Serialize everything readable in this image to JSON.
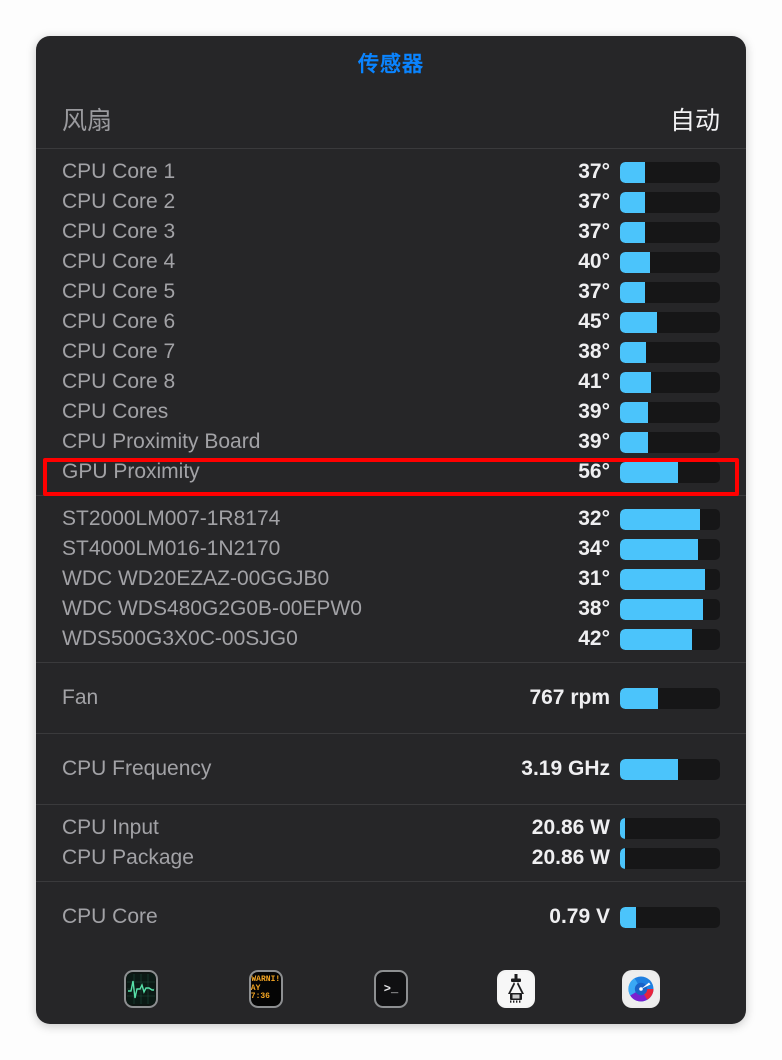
{
  "window": {
    "title": "传感器",
    "accent_color": "#0a84ff",
    "panel_color": "#262628",
    "bar_color": "#4bc4fb",
    "bar_track_color": "#161617",
    "highlight_color": "#ff0000"
  },
  "fan_header": {
    "label": "风扇",
    "value": "自动"
  },
  "sections": [
    {
      "name": "temperatures-cpu",
      "rows": [
        {
          "label": "CPU Core 1",
          "value": "37°",
          "fill": 25
        },
        {
          "label": "CPU Core 2",
          "value": "37°",
          "fill": 25
        },
        {
          "label": "CPU Core 3",
          "value": "37°",
          "fill": 25
        },
        {
          "label": "CPU Core 4",
          "value": "40°",
          "fill": 30
        },
        {
          "label": "CPU Core 5",
          "value": "37°",
          "fill": 25
        },
        {
          "label": "CPU Core 6",
          "value": "45°",
          "fill": 37
        },
        {
          "label": "CPU Core 7",
          "value": "38°",
          "fill": 26
        },
        {
          "label": "CPU Core 8",
          "value": "41°",
          "fill": 31
        },
        {
          "label": "CPU Cores",
          "value": "39°",
          "fill": 28
        },
        {
          "label": "CPU Proximity Board",
          "value": "39°",
          "fill": 28
        },
        {
          "label": "GPU Proximity",
          "value": "56°",
          "fill": 58,
          "highlighted": true
        }
      ]
    },
    {
      "name": "temperatures-drives",
      "rows": [
        {
          "label": "ST2000LM007-1R8174",
          "value": "32°",
          "fill": 80
        },
        {
          "label": "ST4000LM016-1N2170",
          "value": "34°",
          "fill": 78
        },
        {
          "label": "WDC WD20EZAZ-00GGJB0",
          "value": "31°",
          "fill": 85
        },
        {
          "label": "WDC WDS480G2G0B-00EPW0",
          "value": "38°",
          "fill": 83
        },
        {
          "label": "WDS500G3X0C-00SJG0",
          "value": "42°",
          "fill": 72
        }
      ]
    },
    {
      "name": "fans",
      "tall": true,
      "rows": [
        {
          "label": "Fan",
          "value": "767 rpm",
          "fill": 38
        }
      ]
    },
    {
      "name": "frequency",
      "tall": true,
      "rows": [
        {
          "label": "CPU Frequency",
          "value": "3.19 GHz",
          "fill": 58
        }
      ]
    },
    {
      "name": "power",
      "rows": [
        {
          "label": "CPU Input",
          "value": "20.86 W",
          "fill": 5
        },
        {
          "label": "CPU Package",
          "value": "20.86 W",
          "fill": 5
        }
      ]
    },
    {
      "name": "voltage",
      "tall": true,
      "rows": [
        {
          "label": "CPU Core",
          "value": "0.79 V",
          "fill": 16
        }
      ]
    }
  ],
  "toolbar": {
    "items": [
      {
        "name": "activity-monitor-icon",
        "kind": "activity",
        "label": "Activity Monitor"
      },
      {
        "name": "warning-watch-icon",
        "kind": "warn",
        "label": "WARNI!",
        "line2": "AY 7:36"
      },
      {
        "name": "terminal-icon",
        "kind": "terminal",
        "label": "Terminal",
        "prompt": ">_"
      },
      {
        "name": "power-gadget-icon",
        "kind": "gadget",
        "label": "Intel Power Gadget"
      },
      {
        "name": "istat-menus-icon",
        "kind": "istat",
        "label": "iStat Menus"
      }
    ]
  }
}
